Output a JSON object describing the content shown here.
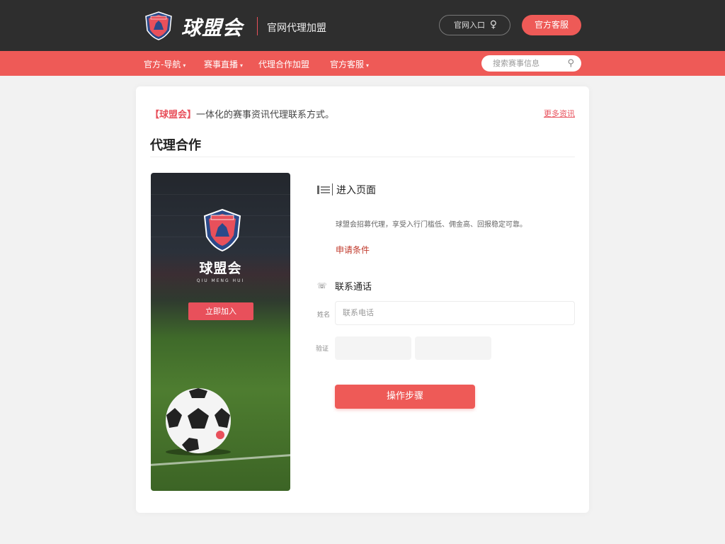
{
  "header": {
    "brand": "球盟会",
    "slogan": "官网代理加盟",
    "search_pill": "官网入口",
    "top_button": "官方客服"
  },
  "nav": {
    "items": [
      {
        "label": "官方-导航"
      },
      {
        "label": "赛事直播"
      },
      {
        "label": "代理合作加盟"
      },
      {
        "label": "官方客服"
      }
    ],
    "search_placeholder": "搜索赛事信息"
  },
  "card": {
    "notice_tag": "【球盟会】",
    "notice_text": "一体化的赛事资讯代理联系方式。",
    "notice_link": "更多资讯",
    "title": "代理合作"
  },
  "promo": {
    "brand": "球盟会",
    "sub": "QIU MENG HUI",
    "button": "立即加入"
  },
  "section1": {
    "title": "进入页面",
    "desc": "球盟会招募代理，享受入行门槛低、佣金高、回报稳定可靠。",
    "link": "申请条件"
  },
  "section2": {
    "title": "联系通话",
    "label_name": "姓名",
    "placeholder_name": "联系电话",
    "label_code": "验证"
  },
  "submit": {
    "label": "操作步骤"
  },
  "colors": {
    "accent": "#ee5a57",
    "header_dark": "#2e2e2e"
  }
}
